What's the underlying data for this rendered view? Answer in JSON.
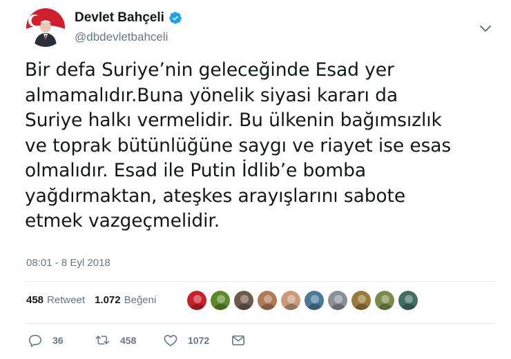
{
  "user": {
    "display_name": "Devlet Bahçeli",
    "handle": "@dbdevletbahceli",
    "verified": true
  },
  "tweet": {
    "text": "Bir defa Suriye’nin geleceğinde Esad yer\nalmamalıdır.Buna yönelik siyasi kararı da\nSuriye halkı vermelidir. Bu ülkenin bağımsızlık\nve toprak bütünlüğüne saygı ve riayet ise esas\nolmalıdır. Esad ile Putin İdlib’e bomba\nyağdırmaktan, ateşkes arayışlarını sabote\netmek vazgeçmelidir.",
    "timestamp": "08:01 - 8 Eyl 2018"
  },
  "stats": {
    "retweet_count": "458",
    "retweet_label": "Retweet",
    "like_count": "1.072",
    "like_label": "Beğeni"
  },
  "likers": [
    {
      "icon": "avatar-red-emblem",
      "color": "#c8202b"
    },
    {
      "icon": "avatar-green-emblem",
      "color": "#5b8a2a"
    },
    {
      "icon": "avatar-group-photo",
      "color": "#6d5a4a"
    },
    {
      "icon": "avatar-woman-photo",
      "color": "#b07a55"
    },
    {
      "icon": "avatar-woman-photo-2",
      "color": "#c99a7a"
    },
    {
      "icon": "avatar-sea-photo",
      "color": "#4a7a96"
    },
    {
      "icon": "avatar-man-photo",
      "color": "#8a8f95"
    },
    {
      "icon": "avatar-landscape-photo",
      "color": "#9a7a3a"
    },
    {
      "icon": "avatar-field-photo",
      "color": "#7a8a4a"
    },
    {
      "icon": "avatar-lake-photo",
      "color": "#3f6f62"
    }
  ],
  "actions": {
    "reply_count": "36",
    "retweet_count": "458",
    "like_count": "1072"
  },
  "colors": {
    "text": "#14171a",
    "secondary": "#657786",
    "verified_blue": "#1da1f2",
    "avatar_red": "#d0202e"
  }
}
